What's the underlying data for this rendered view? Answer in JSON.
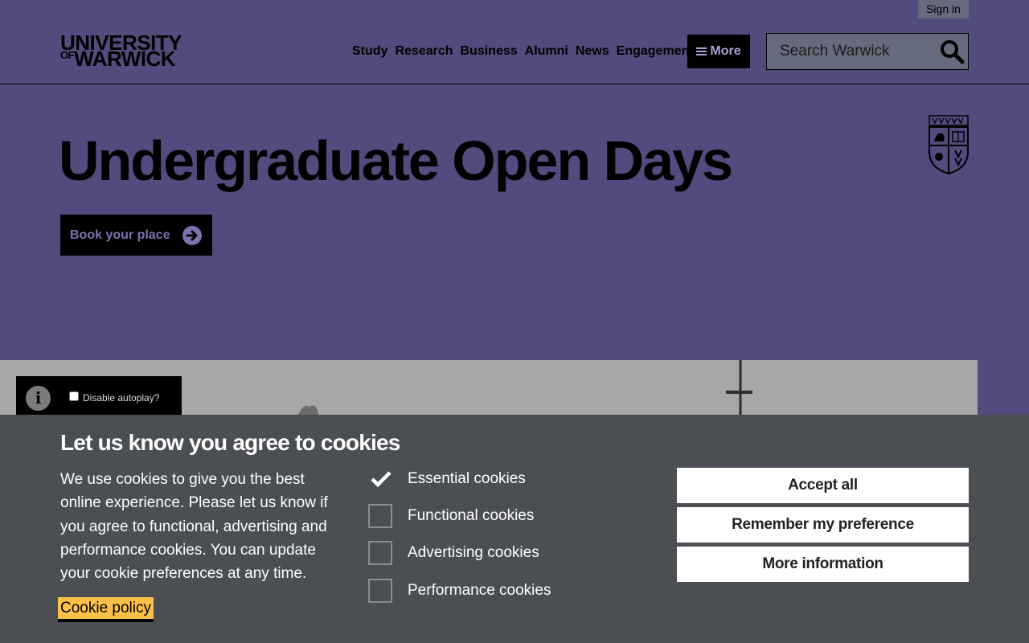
{
  "header": {
    "sign_in": "Sign in",
    "logo": {
      "line1": "UNIVERSITY",
      "line2_prefix": "OF",
      "line2": "WARWICK"
    },
    "nav": [
      "Study",
      "Research",
      "Business",
      "Alumni",
      "News",
      "Engagement"
    ],
    "more_label": "More",
    "search_placeholder": "Search Warwick"
  },
  "hero": {
    "title": "Undergraduate Open Days",
    "cta_label": "Book your place"
  },
  "video": {
    "info_icon": "i",
    "autoplay_label": "Disable autoplay?"
  },
  "cookie_banner": {
    "title": "Let us know you agree to cookies",
    "text": "We use cookies to give you the best online experience. Please let us know if you agree to functional, advertising and performance cookies. You can update your cookie preferences at any time.",
    "policy_link": "Cookie policy",
    "options": [
      {
        "label": "Essential cookies",
        "checked": true
      },
      {
        "label": "Functional cookies",
        "checked": false
      },
      {
        "label": "Advertising cookies",
        "checked": false
      },
      {
        "label": "Performance cookies",
        "checked": false
      }
    ],
    "buttons": {
      "accept": "Accept all",
      "remember": "Remember my preference",
      "more_info": "More information"
    }
  },
  "colors": {
    "brand_purple": "#524b7d",
    "banner_bg": "#4b4f53",
    "policy_highlight": "#fcbf49"
  }
}
